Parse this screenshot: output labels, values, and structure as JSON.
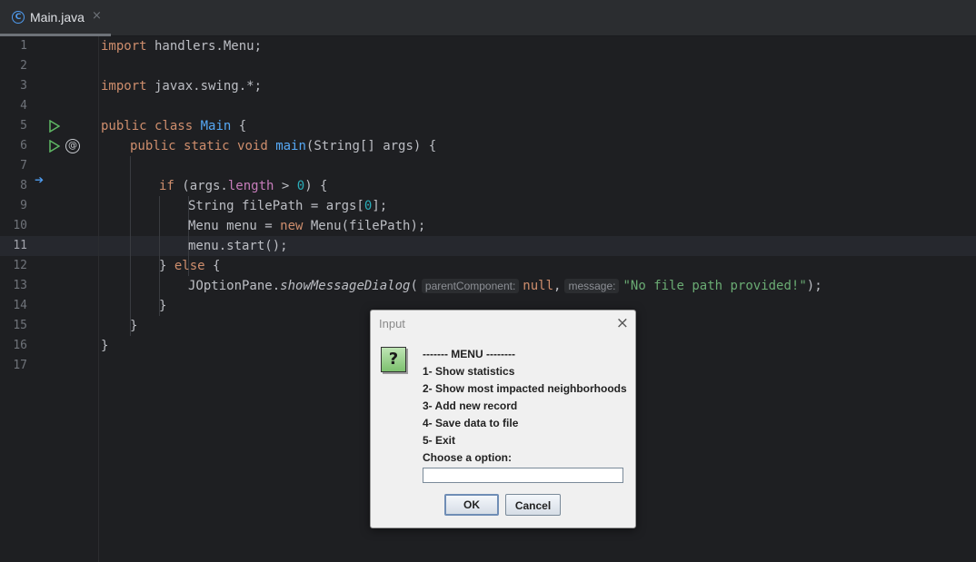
{
  "tab": {
    "icon": "class-file-icon",
    "name": "Main.java",
    "close": "×"
  },
  "gutter": {
    "line_numbers": [
      "1",
      "2",
      "3",
      "4",
      "5",
      "6",
      "7",
      "8",
      "9",
      "10",
      "11",
      "12",
      "13",
      "14",
      "15",
      "16",
      "17"
    ],
    "current_line": "11"
  },
  "code": {
    "l1": {
      "kw": "import",
      "rest": " handlers.Menu;"
    },
    "l3": {
      "kw": "import",
      "rest": " javax.swing.*;"
    },
    "l5": {
      "kw1": "public",
      "kw2": "class",
      "name": "Main",
      "rest": " {"
    },
    "l6": {
      "kw1": "public",
      "kw2": "static",
      "kw3": "void",
      "fn": "main",
      "rest": "(String[] args) {"
    },
    "l8": {
      "kw": "if",
      "a": " (args.",
      "fld": "length",
      "b": " > ",
      "num": "0",
      "c": ") {"
    },
    "l9": {
      "a": "String filePath = args[",
      "num": "0",
      "b": "];"
    },
    "l10": {
      "a": "Menu menu = ",
      "kw": "new",
      "b": " Menu(filePath);"
    },
    "l11": {
      "a": "menu.start();"
    },
    "l12": {
      "a": "} ",
      "kw": "else",
      "b": " {"
    },
    "l13": {
      "a": "JOptionPane.",
      "fn": "showMessageDialog",
      "b": "(",
      "hint1": "parentComponent:",
      "kw": "null",
      "c": ",",
      "hint2": "message:",
      "str": "\"No file path provided!\"",
      "d": ");"
    },
    "l14": {
      "a": "}"
    },
    "l15": {
      "a": "}"
    },
    "l16": {
      "a": "}"
    }
  },
  "dialog": {
    "title": "Input",
    "close": "×",
    "icon": "question-icon",
    "icon_glyph": "?",
    "lines": [
      "------- MENU --------",
      "1- Show statistics",
      "2- Show most impacted neighborhoods",
      "3- Add new record",
      "4- Save data to file",
      "5- Exit",
      "Choose a option:"
    ],
    "input_value": "",
    "ok_label": "OK",
    "cancel_label": "Cancel"
  },
  "colors": {
    "editor_bg": "#1e1f22",
    "keyword": "#cf8e6d",
    "string": "#6aab73",
    "number": "#2aacb8",
    "function": "#56a8f5"
  }
}
